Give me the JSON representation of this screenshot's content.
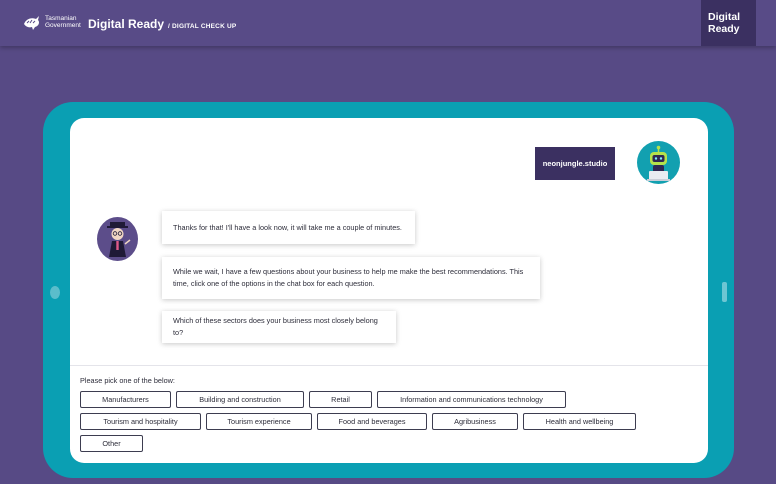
{
  "header": {
    "gov_line1": "Tasmanian",
    "gov_line2": "Government",
    "brand": "Digital Ready",
    "sub": "/ DIGITAL CHECK UP",
    "badge_line1": "Digital",
    "badge_line2": "Ready"
  },
  "chat": {
    "user_message": "neonjungle.studio",
    "messages": [
      "Thanks for that! I'll have a look now, it will take me a couple of minutes.",
      "While we wait, I have a few questions about your business to help me make the best recommendations. This time, click one of the options in the chat box for each question.",
      "Which of these sectors does your business most closely belong to?"
    ]
  },
  "options": {
    "prompt": "Please pick one of the below:",
    "items": [
      "Manufacturers",
      "Building and construction",
      "Retail",
      "Information and communications technology",
      "Tourism and hospitality",
      "Tourism experience",
      "Food and beverages",
      "Agribusiness",
      "Health and wellbeing",
      "Other"
    ]
  },
  "colors": {
    "background": "#574a85",
    "tablet": "#0a9fb3",
    "dark_purple": "#3b3061"
  }
}
